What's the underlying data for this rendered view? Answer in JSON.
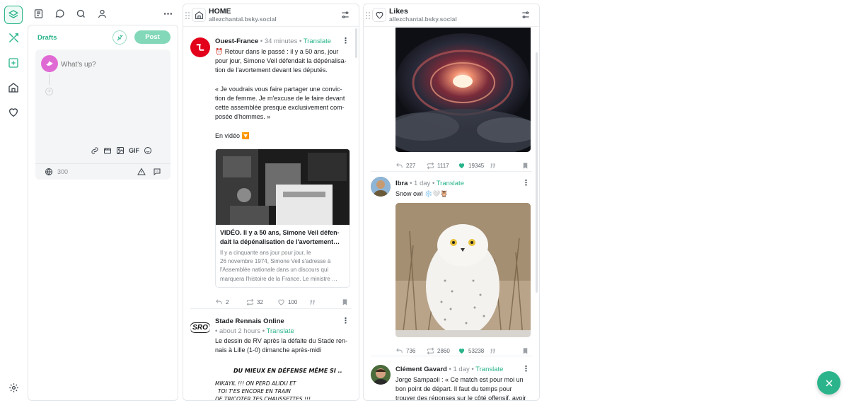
{
  "nav": {
    "rail": [
      "layers-icon",
      "tools-icon",
      "add-column-icon",
      "home-icon",
      "heart-icon",
      "settings-icon"
    ],
    "top": [
      "list-icon",
      "chat-icon",
      "search-icon",
      "user-icon",
      "more-icon"
    ]
  },
  "drafts": {
    "title": "Drafts",
    "post_label": "Post",
    "placeholder": "What's up?",
    "char_count": "300",
    "toolbar": {
      "gif": "GIF"
    }
  },
  "home": {
    "title": "HOME",
    "handle": "allezchantal.bsky.social",
    "posts": [
      {
        "author": "Ouest-France",
        "time": "34 minutes",
        "translate": "Translate",
        "text_lines": [
          "⏰ Retour dans le passé : il y a 50 ans, jour",
          "pour jour, Simone Veil défendait la dépénalisa-",
          "tion de l'avortement devant les députés.",
          "",
          "« Je voudrais vous faire partager une convic-",
          "tion de femme. Je m'excuse de le faire devant",
          "cette assemblée presque exclusivement com-",
          "posée d'hommes. »",
          "",
          "En vidéo 🔽"
        ],
        "card": {
          "title_lines": [
            "VIDÉO. Il y a 50 ans, Simone Veil défen-",
            "dait la dépénalisation de l'avortement…"
          ],
          "desc_lines": [
            "Il y a cinquante ans jour pour jour, le",
            "26 novembre 1974, Simone Veil s'adresse à",
            "l'Assemblée nationale dans un discours qui",
            "marquera l'histoire de la France. Le ministre …"
          ]
        },
        "replies": "2",
        "reposts": "32",
        "likes": "100"
      },
      {
        "author": "Stade Rennais Online",
        "avatar_text": "SRO",
        "time": "about 2 hours",
        "translate": "Translate",
        "text_lines": [
          "Le dessin de RV après la défaite du Stade ren-",
          "nais à Lille (1-0) dimanche après-midi"
        ],
        "comic_lines": [
          "DU MIEUX EN DÉFENSE MÊME SI ..",
          "MIKAYIL !!! ON PERD ALIDU ET",
          "TOI T'ES ENCORE EN TRAIN",
          "DE TRICOTER TES CHAUSSETTES !!!"
        ]
      }
    ]
  },
  "likes": {
    "title": "Likes",
    "handle": "allezchantal.bsky.social",
    "posts": [
      {
        "replies": "227",
        "reposts": "1117",
        "likes": "19345"
      },
      {
        "author": "Ibra",
        "time": "1 day",
        "translate": "Translate",
        "text": "Snow owl ❄️🤍🦉",
        "replies": "736",
        "reposts": "2860",
        "likes": "53238"
      },
      {
        "author": "Clément Gavard",
        "time": "1 day",
        "translate": "Translate",
        "text_lines": [
          "Jorge Sampaoli : « Ce match est pour moi un",
          "bon point de départ. Il faut du temps pour",
          "trouver des réponses sur le côté offensif, avoir"
        ]
      }
    ]
  },
  "colors": {
    "accent": "#2bb48b",
    "border": "#e3e6ea",
    "muted": "#8a9096"
  }
}
